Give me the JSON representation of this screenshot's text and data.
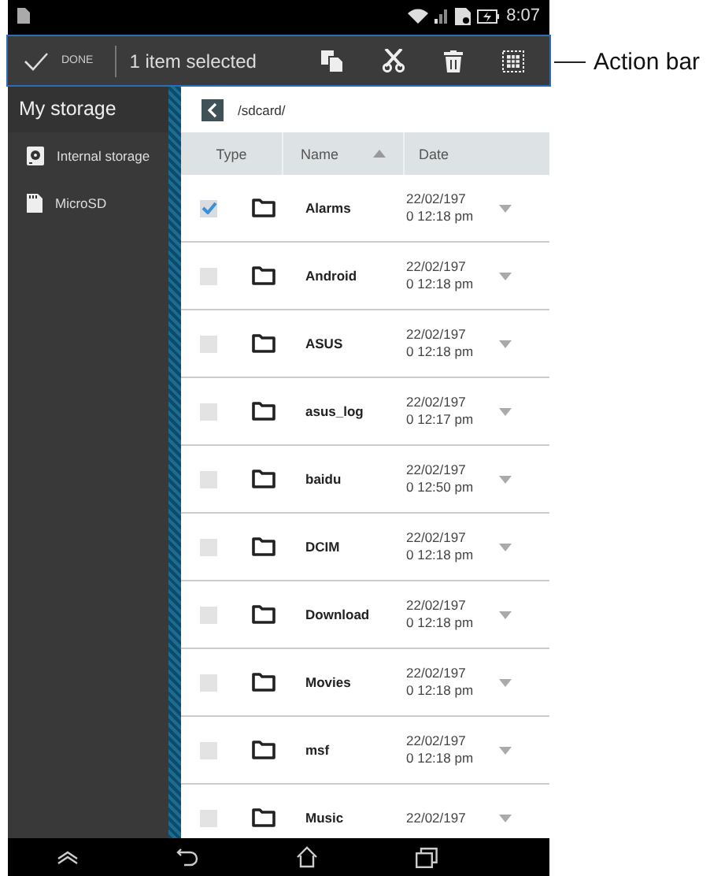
{
  "status_bar": {
    "time": "8:07"
  },
  "action_bar": {
    "done_label": "DONE",
    "title": "1 item selected",
    "callout": "Action bar"
  },
  "sidebar": {
    "title": "My storage",
    "items": [
      {
        "label": "Internal storage",
        "kind": "internal",
        "selected": false
      },
      {
        "label": "MicroSD",
        "kind": "sd",
        "selected": false
      }
    ]
  },
  "path": "/sdcard/",
  "table": {
    "columns": [
      "Type",
      "Name",
      "Date"
    ],
    "rows": [
      {
        "name": "Alarms",
        "checked": true,
        "date": [
          "22/02/197",
          "0 12:18 pm"
        ]
      },
      {
        "name": "Android",
        "checked": false,
        "date": [
          "22/02/197",
          "0 12:18 pm"
        ]
      },
      {
        "name": "ASUS",
        "checked": false,
        "date": [
          "22/02/197",
          "0 12:18 pm"
        ]
      },
      {
        "name": "asus_log",
        "checked": false,
        "date": [
          "22/02/197",
          "0 12:17 pm"
        ]
      },
      {
        "name": "baidu",
        "checked": false,
        "date": [
          "22/02/197",
          "0 12:50 pm"
        ]
      },
      {
        "name": "DCIM",
        "checked": false,
        "date": [
          "22/02/197",
          "0 12:18 pm"
        ]
      },
      {
        "name": "Download",
        "checked": false,
        "date": [
          "22/02/197",
          "0 12:18 pm"
        ]
      },
      {
        "name": "Movies",
        "checked": false,
        "date": [
          "22/02/197",
          "0 12:18 pm"
        ]
      },
      {
        "name": "msf",
        "checked": false,
        "date": [
          "22/02/197",
          "0 12:18 pm"
        ]
      },
      {
        "name": "Music",
        "checked": false,
        "date": [
          "22/02/197"
        ]
      }
    ]
  }
}
